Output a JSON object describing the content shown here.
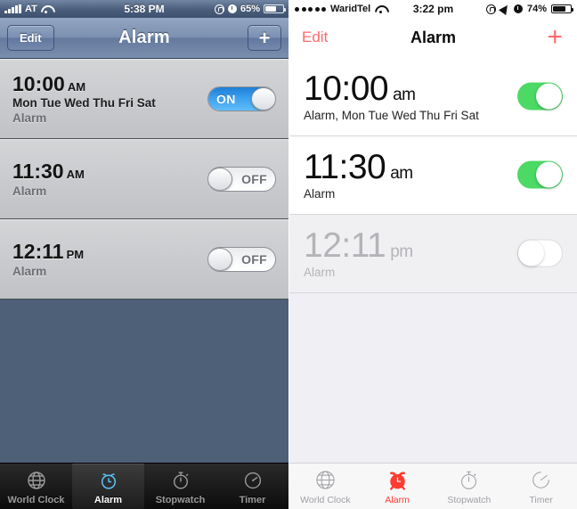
{
  "left": {
    "platform_label": "iOS 6",
    "status": {
      "carrier": "AT",
      "signal_icon": "signal-bars-icon",
      "wifi_icon": "wifi-icon",
      "time": "5:38 PM",
      "rotation_lock_icon": "rotation-lock-icon",
      "alarm_icon": "alarm-clock-icon",
      "battery_percent": "65%",
      "battery_icon": "battery-icon",
      "battery_level": 65
    },
    "nav": {
      "edit_label": "Edit",
      "title": "Alarm",
      "add_label": "+"
    },
    "alarms": [
      {
        "time": "10:00",
        "meridiem": "AM",
        "days": "Mon Tue Wed Thu Fri Sat",
        "label": "Alarm",
        "toggle_state": "ON",
        "enabled": true
      },
      {
        "time": "11:30",
        "meridiem": "AM",
        "days": "",
        "label": "Alarm",
        "toggle_state": "OFF",
        "enabled": false
      },
      {
        "time": "12:11",
        "meridiem": "PM",
        "days": "",
        "label": "Alarm",
        "toggle_state": "OFF",
        "enabled": false
      }
    ],
    "tabs": [
      {
        "label": "World Clock",
        "icon": "globe-icon",
        "active": false
      },
      {
        "label": "Alarm",
        "icon": "alarm-clock-icon",
        "active": true
      },
      {
        "label": "Stopwatch",
        "icon": "stopwatch-icon",
        "active": false
      },
      {
        "label": "Timer",
        "icon": "timer-icon",
        "active": false
      }
    ],
    "accent_color": "#58c4f5",
    "toggle_on_color": "#3ba0ef"
  },
  "right": {
    "platform_label": "iOS 7",
    "status": {
      "carrier": "WaridTel",
      "signal_icon": "signal-dots-icon",
      "wifi_icon": "wifi-icon",
      "time": "3:22 pm",
      "rotation_lock_icon": "rotation-lock-icon",
      "location_icon": "location-arrow-icon",
      "alarm_icon": "alarm-clock-icon",
      "battery_percent": "74%",
      "battery_icon": "battery-icon",
      "battery_level": 74
    },
    "nav": {
      "edit_label": "Edit",
      "title": "Alarm",
      "add_label": "+"
    },
    "alarms": [
      {
        "time": "10:00",
        "meridiem": "am",
        "subtitle": "Alarm, Mon Tue Wed Thu Fri Sat",
        "toggle_state": "on",
        "enabled": true
      },
      {
        "time": "11:30",
        "meridiem": "am",
        "subtitle": "Alarm",
        "toggle_state": "on",
        "enabled": true
      },
      {
        "time": "12:11",
        "meridiem": "pm",
        "subtitle": "Alarm",
        "toggle_state": "off",
        "enabled": false
      }
    ],
    "tabs": [
      {
        "label": "World Clock",
        "icon": "globe-icon",
        "active": false
      },
      {
        "label": "Alarm",
        "icon": "alarm-clock-icon",
        "active": true
      },
      {
        "label": "Stopwatch",
        "icon": "stopwatch-icon",
        "active": false
      },
      {
        "label": "Timer",
        "icon": "timer-icon",
        "active": false
      }
    ],
    "accent_color": "#ff3b30",
    "toggle_on_color": "#4cd964"
  }
}
